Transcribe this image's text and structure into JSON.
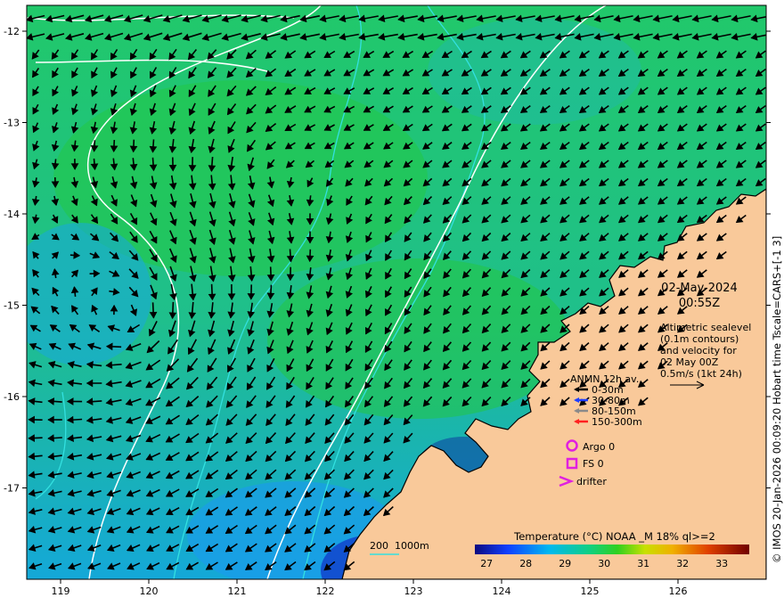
{
  "map": {
    "lon_ticks": [
      "119",
      "120",
      "121",
      "122",
      "123",
      "124",
      "125",
      "126"
    ],
    "lat_ticks": [
      "-12",
      "-13",
      "-14",
      "-15",
      "-16",
      "-17"
    ],
    "date": "02-May-2024",
    "time": "00:55Z",
    "altimetry_note": [
      "Altimetric sealevel",
      "(0.1m contours)",
      "and velocity for",
      "02 May 00Z",
      "0.5m/s (1kt 24h)"
    ],
    "side_credit": "© IMOS 20-Jan-2026 00:09:20 Hobart time Tscale=CARS+[-1 3]",
    "depth_legend": "200  1000m",
    "colors": {
      "land": "#f9c99a",
      "shelf_contour": "#33e0e0",
      "sealevel_contour": "#ffffff",
      "arrow": "#000000"
    }
  },
  "anmn_legend": {
    "title": "ANMN 12h av.",
    "items": [
      {
        "label": "0-30m",
        "color": "#000000"
      },
      {
        "label": "30-80m",
        "color": "#1f3fff"
      },
      {
        "label": "80-150m",
        "color": "#8a8a8a"
      },
      {
        "label": "150-300m",
        "color": "#ff2020"
      }
    ]
  },
  "platforms": [
    {
      "label": "Argo 0",
      "color": "#e020e0",
      "symbol": "circle-icon"
    },
    {
      "label": "FS 0",
      "color": "#e020e0",
      "symbol": "square-icon"
    },
    {
      "label": "drifter",
      "color": "#e020e0",
      "symbol": "chevron-icon"
    }
  ],
  "colorbar": {
    "title": "Temperature (°C) NOAA _M 18% ql>=2",
    "ticks": [
      "27",
      "28",
      "29",
      "30",
      "31",
      "32",
      "33"
    ],
    "min": 26.7,
    "max": 33.7
  }
}
